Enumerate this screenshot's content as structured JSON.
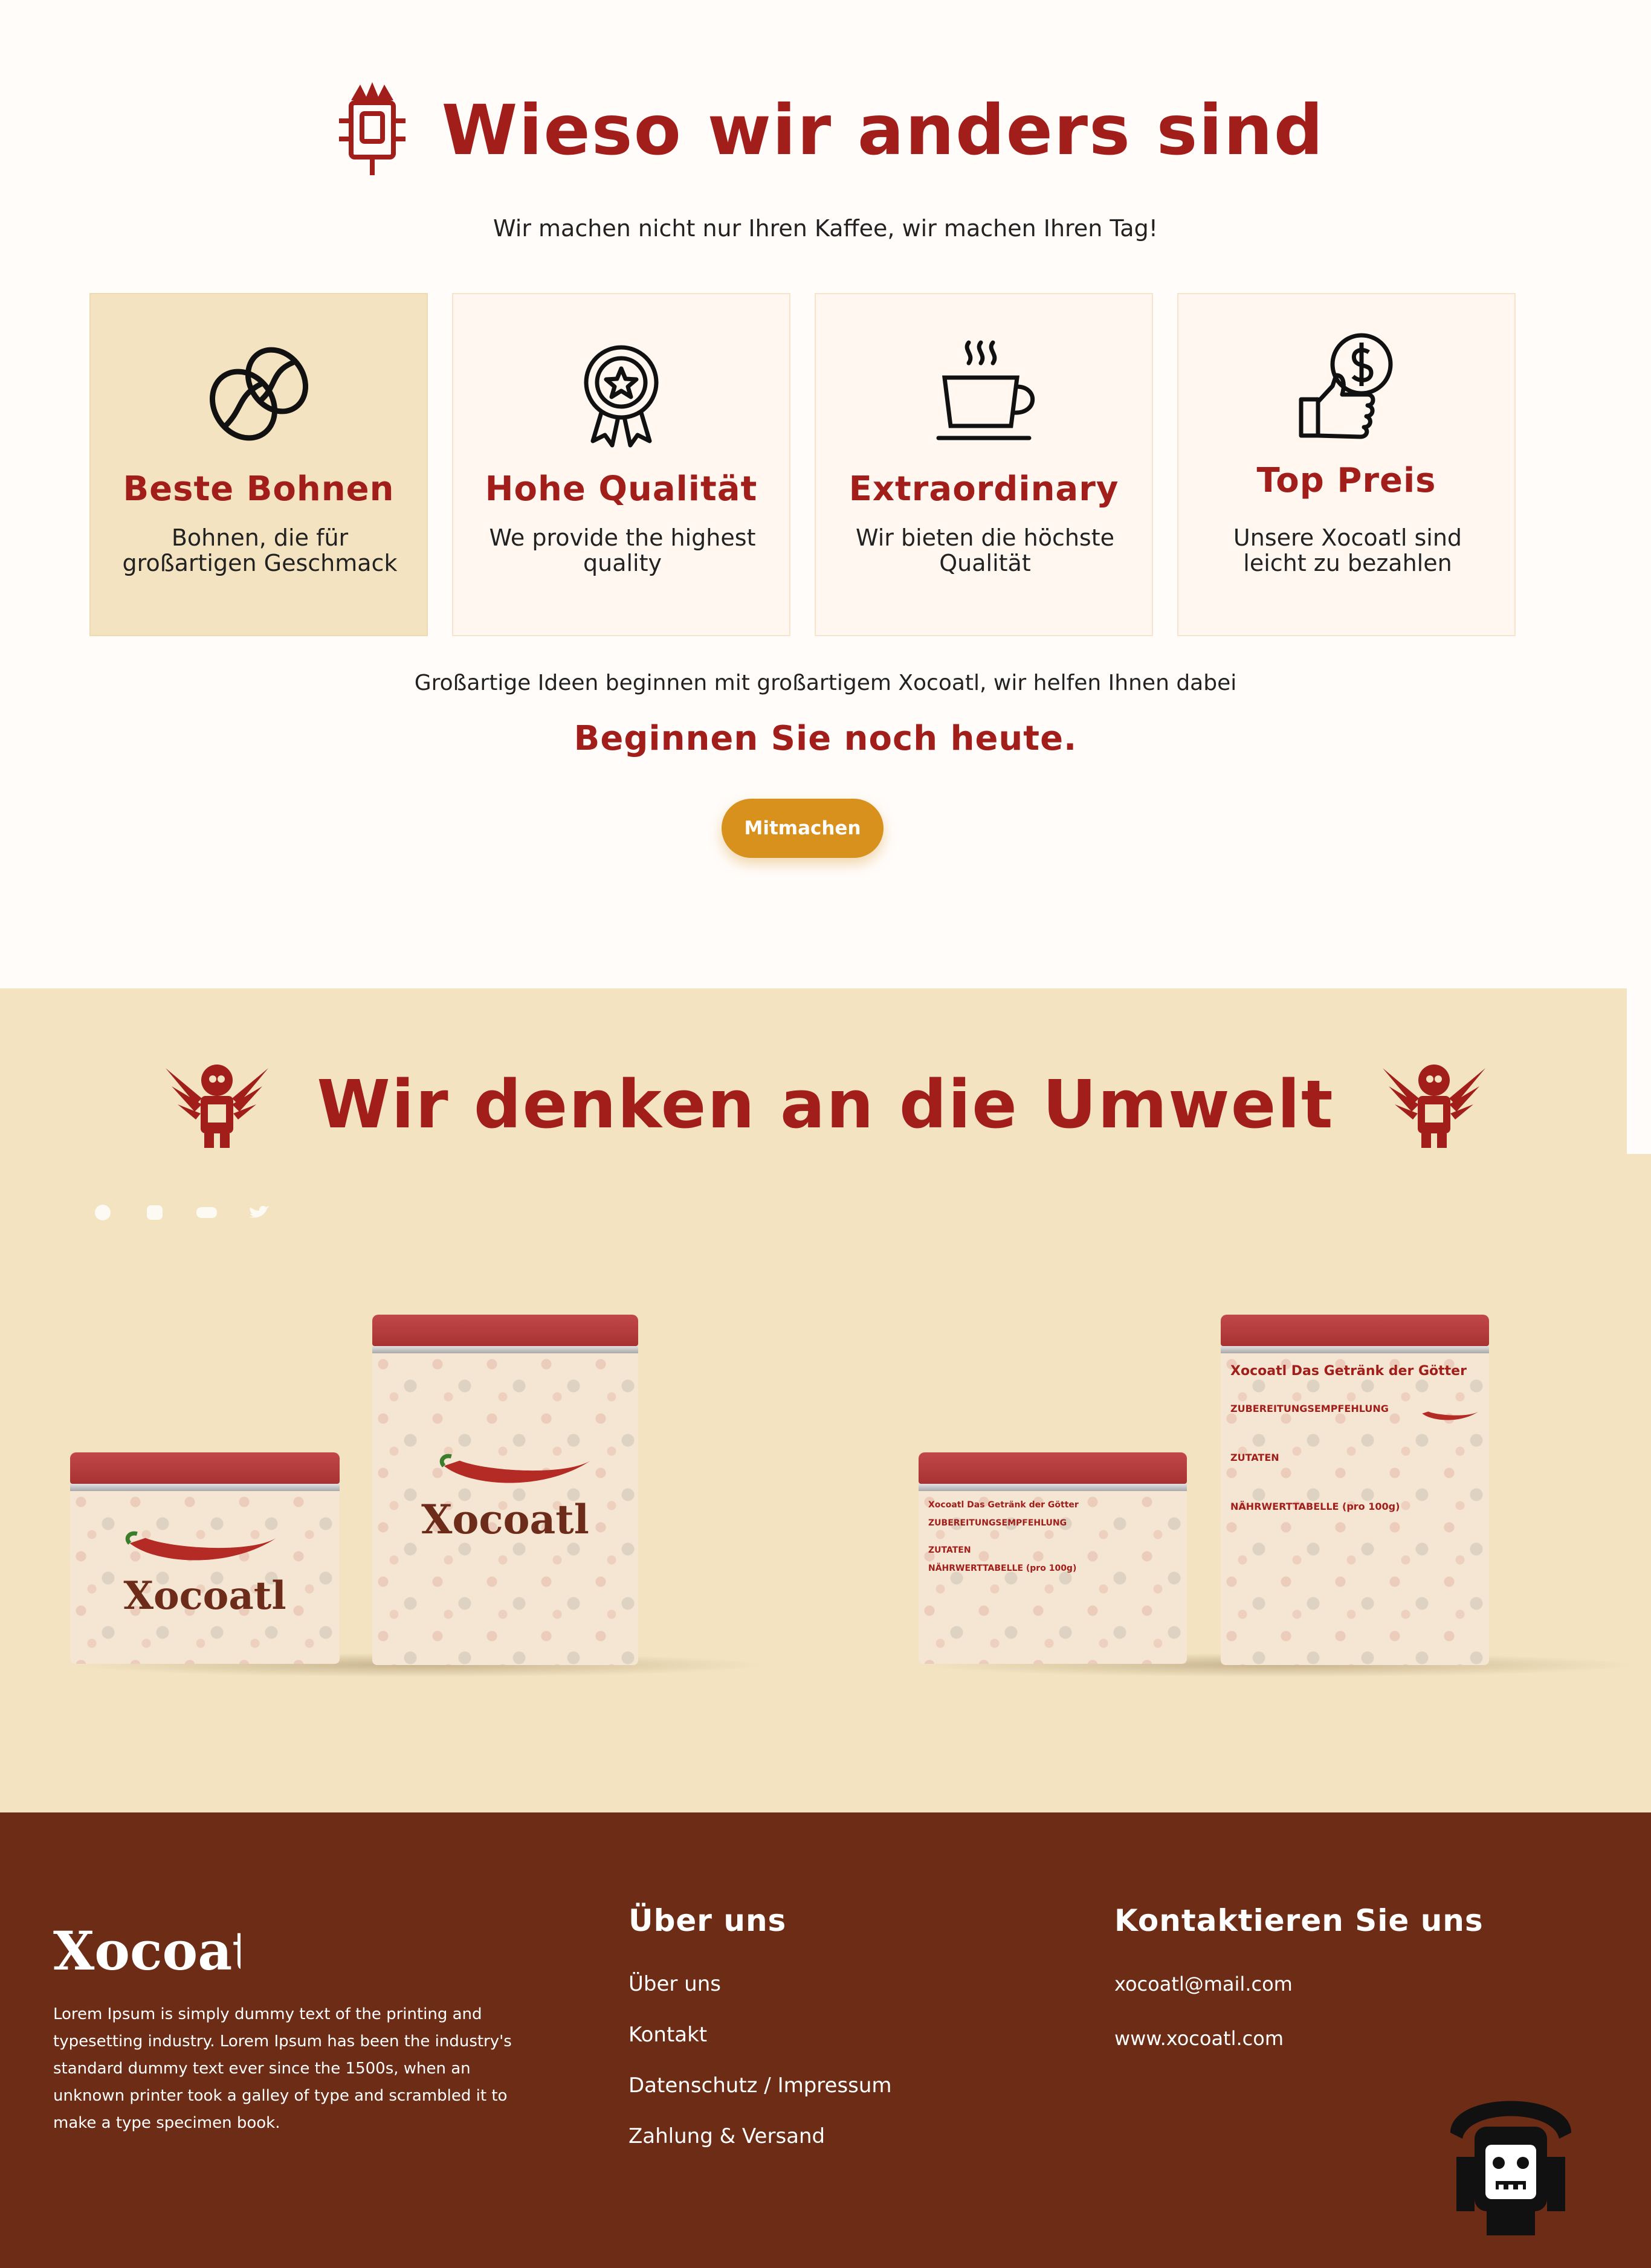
{
  "colors": {
    "accent": "#a11e1a",
    "cream": "#f3e3c0",
    "card_bg": "#fff7f0",
    "button": "#d8911c",
    "footer": "#6c2c15"
  },
  "section1": {
    "title": "Wieso wir anders sind",
    "subtitle": "Wir machen nicht nur Ihren Kaffee, wir machen Ihren Tag!",
    "cards": [
      {
        "icon": "coffee-beans-icon",
        "title": "Beste Bohnen",
        "text": "Bohnen, die für großartigen Geschmack"
      },
      {
        "icon": "quality-badge-icon",
        "title": "Hohe Qualität",
        "text": "We provide the highest quality"
      },
      {
        "icon": "coffee-cup-icon",
        "title": "Extraordinary",
        "text": "Wir bieten die höchste Qualität"
      },
      {
        "icon": "thumbs-up-dollar-icon",
        "title": "Top Preis",
        "text": "Unsere Xocoatl sind leicht zu bezahlen"
      }
    ],
    "note": "Großartige Ideen beginnen mit großartigem Xocoatl, wir helfen Ihnen dabei",
    "cta_title": "Beginnen Sie noch heute.",
    "cta_button": "Mitmachen"
  },
  "section2": {
    "title": "Wir denken an die Umwelt",
    "social_icons": [
      "facebook-icon",
      "instagram-icon",
      "youtube-icon",
      "twitter-icon"
    ],
    "tins": {
      "brand": "Xocoatl",
      "back_title": "Xocoatl   Das Getränk der Götter",
      "back_heading_1": "ZUBEREITUNGSEMPFEHLUNG",
      "back_heading_2": "ZUTATEN",
      "back_heading_3": "NÄHRWERTTABELLE (pro 100g)"
    }
  },
  "footer": {
    "logo_text": "Xocoatl",
    "about": "Lorem Ipsum is simply dummy text of the printing and typesetting industry. Lorem Ipsum has been the industry's standard dummy text ever since the 1500s, when an unknown printer took a galley of type and scrambled it to make a type specimen book.",
    "links_title": "Über uns",
    "links": [
      "Über uns",
      "Kontakt",
      "Datenschutz / Impressum",
      "Zahlung & Versand"
    ],
    "contact_title": "Kontaktieren Sie uns",
    "email": "xocoatl@mail.com",
    "website": "www.xocoatl.com"
  }
}
